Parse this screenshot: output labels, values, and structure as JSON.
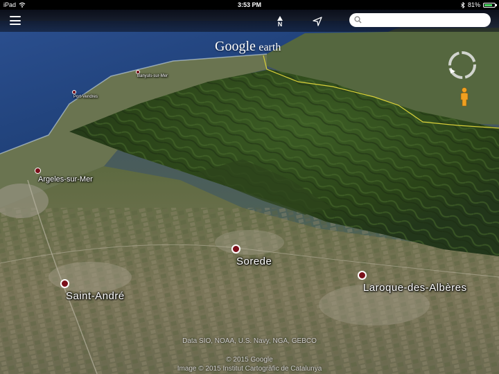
{
  "status_bar": {
    "device": "iPad",
    "time": "3:53 PM",
    "battery": "81%",
    "battery_level": 0.81
  },
  "toolbar": {
    "menu_icon": "hamburger-menu-icon",
    "north_label": "N",
    "north_icon": "north-arrow-icon",
    "locate_icon": "location-arrow-icon",
    "search": {
      "value": "",
      "placeholder": "",
      "icon": "search-icon"
    }
  },
  "logo": {
    "google": "Google",
    "earth": "earth"
  },
  "controls": {
    "compass_icon": "compass-icon",
    "pegman_icon": "pegman-icon"
  },
  "places": [
    {
      "id": "port-vendres",
      "label": "Port-Vendres",
      "size": "sm"
    },
    {
      "id": "banyuls",
      "label": "Banyuls-sur-Mer",
      "size": "sm"
    },
    {
      "id": "argeles",
      "label": "Argeles-sur-Mer",
      "size": "md"
    },
    {
      "id": "sorede",
      "label": "Sorede",
      "size": "lg"
    },
    {
      "id": "saint-andre",
      "label": "Saint-André",
      "size": "lg"
    },
    {
      "id": "laroque",
      "label": "Laroque-des-Albères",
      "size": "lg"
    }
  ],
  "attribution": {
    "data": "Data SIO, NOAA, U.S. Navy, NGA, GEBCO",
    "copyright": "© 2015 Google",
    "image": "Image © 2015 Institut Cartogràfic de Catalunya"
  },
  "colors": {
    "sea": "#1c3f7a",
    "mountains": "#2f4a1c",
    "plains": "#7a7558",
    "border_line": "#d9d03a",
    "place_dot": "#7a0f1a"
  }
}
